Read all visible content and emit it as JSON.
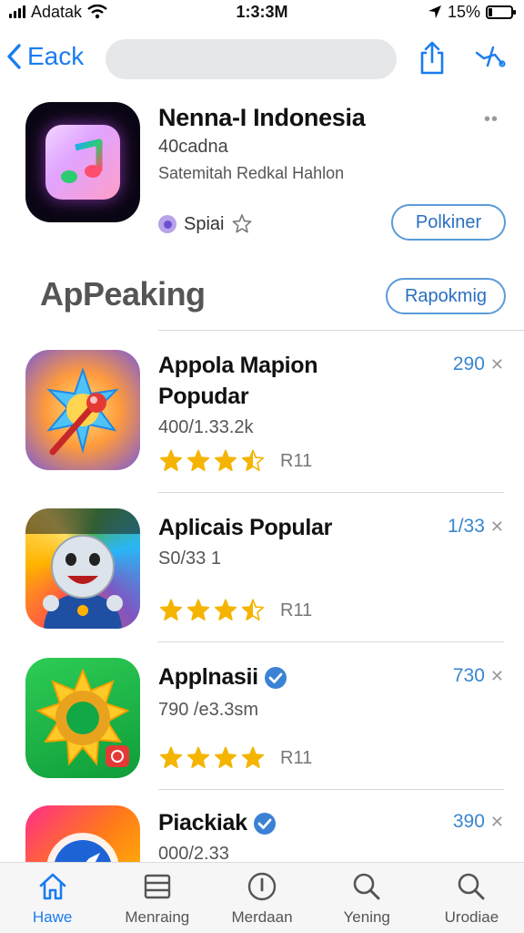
{
  "status_bar": {
    "carrier": "Adatak",
    "time": "1:3:3M",
    "battery": "15%",
    "battery_level": 0.15
  },
  "nav": {
    "back_label": "Eack"
  },
  "hero": {
    "title": "Nenna-I Indonesia",
    "subtitle": "40cadna",
    "developer": "Satemitah Redkal Hahlon",
    "meta_label": "Spiai",
    "action_label": "Polkiner"
  },
  "section": {
    "title": "ApPeaking",
    "action_label": "Rapokmig"
  },
  "apps": [
    {
      "title": "Appola Mapion Popudar",
      "subtitle": "400/1.33.2k",
      "rating": 3.5,
      "rating_count": "R11",
      "price": "290",
      "verified": false,
      "icon": "compass-microphone-icon"
    },
    {
      "title": "Aplicais Popular",
      "subtitle": "S0/33 1",
      "rating": 3.5,
      "rating_count": "R11",
      "price": "1/33",
      "verified": false,
      "icon": "mascot-character-icon"
    },
    {
      "title": "Applnasii",
      "subtitle": "790 /e3.3sm",
      "rating": 4,
      "rating_count": "R11",
      "price": "730",
      "verified": true,
      "icon": "sun-ring-icon"
    },
    {
      "title": "Piackiak",
      "subtitle": "000/2.33",
      "rating": 0,
      "rating_count": "",
      "price": "390",
      "verified": true,
      "icon": "gradient-compass-icon"
    }
  ],
  "tabs": [
    {
      "label": "Hawe",
      "icon": "home-icon",
      "active": true
    },
    {
      "label": "Menraing",
      "icon": "list-icon",
      "active": false
    },
    {
      "label": "Merdaan",
      "icon": "info-circle-icon",
      "active": false
    },
    {
      "label": "Yening",
      "icon": "search-icon",
      "active": false
    },
    {
      "label": "Urodiae",
      "icon": "search-icon",
      "active": false
    }
  ],
  "colors": {
    "accent": "#1a7cf0",
    "star": "#f5b400",
    "price": "#3a86d0"
  }
}
